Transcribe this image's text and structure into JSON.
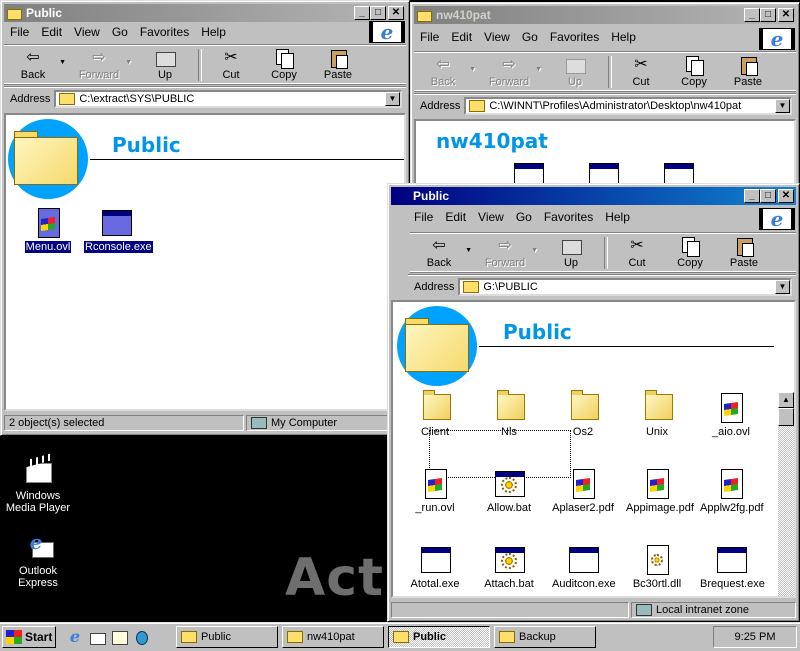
{
  "desktop": {
    "watermark_text": "Acti",
    "icons": [
      {
        "label_line1": "Windows",
        "label_line2": "Media Player",
        "icon": "media-player-icon"
      },
      {
        "label_line1": "Outlook",
        "label_line2": "Express",
        "icon": "outlook-express-icon"
      }
    ]
  },
  "menu": {
    "file": "File",
    "edit": "Edit",
    "view": "View",
    "go": "Go",
    "favorites": "Favorites",
    "help": "Help"
  },
  "toolbar": {
    "back": "Back",
    "forward": "Forward",
    "up": "Up",
    "cut": "Cut",
    "copy": "Copy",
    "paste": "Paste"
  },
  "address_label": "Address",
  "win1": {
    "title": "Public",
    "address": "C:\\extract\\SYS\\PUBLIC",
    "folder_heading": "Public",
    "files": [
      {
        "name": "Menu.ovl",
        "type": "doc",
        "selected": true
      },
      {
        "name": "Rconsole.exe",
        "type": "app",
        "selected": true
      }
    ],
    "status_left": "2 object(s) selected",
    "status_right": "My Computer"
  },
  "win2": {
    "title": "nw410pat",
    "address": "C:\\WINNT\\Profiles\\Administrator\\Desktop\\nw410pat",
    "folder_heading": "nw410pat"
  },
  "win3": {
    "title": "Public",
    "address": "G:\\PUBLIC",
    "folder_heading": "Public",
    "files": [
      {
        "name": "Client",
        "type": "folder"
      },
      {
        "name": "Nls",
        "type": "folder"
      },
      {
        "name": "Os2",
        "type": "folder"
      },
      {
        "name": "Unix",
        "type": "folder"
      },
      {
        "name": "_aio.ovl",
        "type": "doc"
      },
      {
        "name": "_run.ovl",
        "type": "doc"
      },
      {
        "name": "Allow.bat",
        "type": "bat"
      },
      {
        "name": "Aplaser2.pdf",
        "type": "doc"
      },
      {
        "name": "Appimage.pdf",
        "type": "doc"
      },
      {
        "name": "Applw2fg.pdf",
        "type": "doc"
      },
      {
        "name": "Atotal.exe",
        "type": "app"
      },
      {
        "name": "Attach.bat",
        "type": "bat"
      },
      {
        "name": "Auditcon.exe",
        "type": "app"
      },
      {
        "name": "Bc30rtl.dll",
        "type": "dll"
      },
      {
        "name": "Brequest.exe",
        "type": "app"
      }
    ],
    "status_zone": "Local intranet zone"
  },
  "taskbar": {
    "start": "Start",
    "items": [
      {
        "label": "Public",
        "active": false
      },
      {
        "label": "nw410pat",
        "active": false
      },
      {
        "label": "Public",
        "active": true
      },
      {
        "label": "Backup",
        "active": false
      }
    ],
    "clock": "9:25 PM"
  }
}
